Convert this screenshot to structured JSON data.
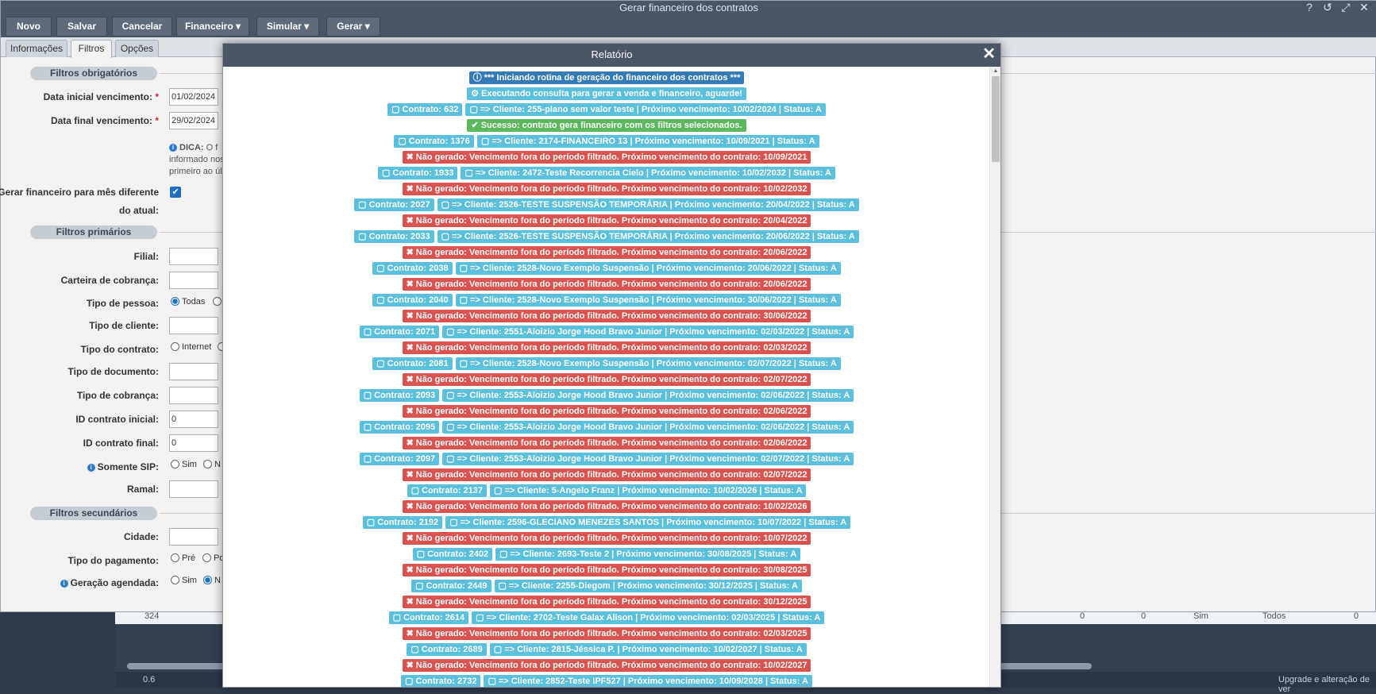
{
  "window": {
    "title": "Gerar financeiro dos contratos",
    "tools": [
      "help-icon",
      "history-icon",
      "expand-icon",
      "close-icon"
    ]
  },
  "toolbar": {
    "novo": "Novo",
    "salvar": "Salvar",
    "cancelar": "Cancelar",
    "financeiro": "Financeiro ▾",
    "simular": "Simular ▾",
    "gerar": "Gerar ▾"
  },
  "tabs": [
    "Informações",
    "Filtros",
    "Opções"
  ],
  "sections": {
    "obrigatorios": "Filtros obrigatórios",
    "primarios": "Filtros primários",
    "secundarios": "Filtros secundários"
  },
  "form": {
    "data_inicial_label": "Data inicial vencimento:",
    "data_inicial_value": "01/02/2024",
    "data_final_label": "Data final vencimento:",
    "data_final_value": "29/02/2024",
    "dica_title": "DICA:",
    "dica_text": "O f informado nos primeiro ao úl",
    "gerar_mes_label_1": "Gerar financeiro para mês diferente",
    "gerar_mes_label_2": "do atual:",
    "filial_label": "Filial:",
    "carteira_label": "Carteira de cobrança:",
    "tipo_pessoa_label": "Tipo de pessoa:",
    "tipo_pessoa_option": "Todas",
    "tipo_cliente_label": "Tipo de cliente:",
    "tipo_contrato_label": "Tipo do contrato:",
    "tipo_contrato_option": "Internet",
    "tipo_documento_label": "Tipo de documento:",
    "tipo_cobranca_label": "Tipo de cobrança:",
    "id_inicial_label": "ID contrato inicial:",
    "id_inicial_value": "0",
    "id_final_label": "ID contrato final:",
    "id_final_value": "0",
    "somente_sip_label": "Somente SIP:",
    "sip_sim": "Sim",
    "sip_nao": "N",
    "ramal_label": "Ramal:",
    "cidade_label": "Cidade:",
    "tipo_pagamento_label": "Tipo do pagamento:",
    "pag_pre": "Pré",
    "pag_pos": "Po",
    "geracao_label": "Geração agendada:",
    "ger_sim": "Sim",
    "ger_nao": "N"
  },
  "background": {
    "row": [
      "324",
      "0",
      "0",
      "Sim",
      "Todos",
      "0"
    ],
    "footer_left": "0.6",
    "footer_right": "Upgrade e alteração de ver"
  },
  "modal": {
    "title": "Relatório",
    "lines": [
      [
        {
          "type": "primary",
          "icon": "ⓘ",
          "text": "*** Iniciando rotina de geração do financeiro dos contratos ***"
        }
      ],
      [
        {
          "type": "info",
          "icon": "⚙",
          "text": "Executando consulta para gerar a venda e financeiro, aguarde!"
        }
      ],
      [
        {
          "type": "info",
          "icon": "▢",
          "text": "Contrato: 632"
        },
        {
          "type": "info",
          "icon": "▢",
          "text": "=> Cliente: 255-plano sem valor teste | Próximo vencimento: 10/02/2024 | Status: A"
        }
      ],
      [
        {
          "type": "success",
          "icon": "✔",
          "text": "Sucesso: contrato gera financeiro com os filtros selecionados."
        }
      ],
      [
        {
          "type": "info",
          "icon": "▢",
          "text": "Contrato: 1376"
        },
        {
          "type": "info",
          "icon": "▢",
          "text": "=> Cliente: 2174-FINANCEIRO 13 | Próximo vencimento: 10/09/2021 | Status: A"
        }
      ],
      [
        {
          "type": "danger",
          "icon": "✖",
          "text": "Não gerado: Vencimento fora do período filtrado. Próximo vencimento do contrato: 10/09/2021"
        }
      ],
      [
        {
          "type": "info",
          "icon": "▢",
          "text": "Contrato: 1933"
        },
        {
          "type": "info",
          "icon": "▢",
          "text": "=> Cliente: 2472-Teste Recorrencia Cielo | Próximo vencimento: 10/02/2032 | Status: A"
        }
      ],
      [
        {
          "type": "danger",
          "icon": "✖",
          "text": "Não gerado: Vencimento fora do período filtrado. Próximo vencimento do contrato: 10/02/2032"
        }
      ],
      [
        {
          "type": "info",
          "icon": "▢",
          "text": "Contrato: 2027"
        },
        {
          "type": "info",
          "icon": "▢",
          "text": "=> Cliente: 2526-TESTE SUSPENSÃO TEMPORÁRIA | Próximo vencimento: 20/04/2022 | Status: A"
        }
      ],
      [
        {
          "type": "danger",
          "icon": "✖",
          "text": "Não gerado: Vencimento fora do período filtrado. Próximo vencimento do contrato: 20/04/2022"
        }
      ],
      [
        {
          "type": "info",
          "icon": "▢",
          "text": "Contrato: 2033"
        },
        {
          "type": "info",
          "icon": "▢",
          "text": "=> Cliente: 2526-TESTE SUSPENSÃO TEMPORÁRIA | Próximo vencimento: 20/06/2022 | Status: A"
        }
      ],
      [
        {
          "type": "danger",
          "icon": "✖",
          "text": "Não gerado: Vencimento fora do período filtrado. Próximo vencimento do contrato: 20/06/2022"
        }
      ],
      [
        {
          "type": "info",
          "icon": "▢",
          "text": "Contrato: 2038"
        },
        {
          "type": "info",
          "icon": "▢",
          "text": "=> Cliente: 2528-Novo Exemplo Suspensão | Próximo vencimento: 20/06/2022 | Status: A"
        }
      ],
      [
        {
          "type": "danger",
          "icon": "✖",
          "text": "Não gerado: Vencimento fora do período filtrado. Próximo vencimento do contrato: 20/06/2022"
        }
      ],
      [
        {
          "type": "info",
          "icon": "▢",
          "text": "Contrato: 2040"
        },
        {
          "type": "info",
          "icon": "▢",
          "text": "=> Cliente: 2528-Novo Exemplo Suspensão | Próximo vencimento: 30/06/2022 | Status: A"
        }
      ],
      [
        {
          "type": "danger",
          "icon": "✖",
          "text": "Não gerado: Vencimento fora do período filtrado. Próximo vencimento do contrato: 30/06/2022"
        }
      ],
      [
        {
          "type": "info",
          "icon": "▢",
          "text": "Contrato: 2071"
        },
        {
          "type": "info",
          "icon": "▢",
          "text": "=> Cliente: 2551-Aloizio Jorge Hood Bravo Junior | Próximo vencimento: 02/03/2022 | Status: A"
        }
      ],
      [
        {
          "type": "danger",
          "icon": "✖",
          "text": "Não gerado: Vencimento fora do período filtrado. Próximo vencimento do contrato: 02/03/2022"
        }
      ],
      [
        {
          "type": "info",
          "icon": "▢",
          "text": "Contrato: 2081"
        },
        {
          "type": "info",
          "icon": "▢",
          "text": "=> Cliente: 2528-Novo Exemplo Suspensão | Próximo vencimento: 02/07/2022 | Status: A"
        }
      ],
      [
        {
          "type": "danger",
          "icon": "✖",
          "text": "Não gerado: Vencimento fora do período filtrado. Próximo vencimento do contrato: 02/07/2022"
        }
      ],
      [
        {
          "type": "info",
          "icon": "▢",
          "text": "Contrato: 2093"
        },
        {
          "type": "info",
          "icon": "▢",
          "text": "=> Cliente: 2553-Aloizio Jorge Hood Bravo Junior | Próximo vencimento: 02/06/2022 | Status: A"
        }
      ],
      [
        {
          "type": "danger",
          "icon": "✖",
          "text": "Não gerado: Vencimento fora do período filtrado. Próximo vencimento do contrato: 02/06/2022"
        }
      ],
      [
        {
          "type": "info",
          "icon": "▢",
          "text": "Contrato: 2095"
        },
        {
          "type": "info",
          "icon": "▢",
          "text": "=> Cliente: 2553-Aloizio Jorge Hood Bravo Junior | Próximo vencimento: 02/06/2022 | Status: A"
        }
      ],
      [
        {
          "type": "danger",
          "icon": "✖",
          "text": "Não gerado: Vencimento fora do período filtrado. Próximo vencimento do contrato: 02/06/2022"
        }
      ],
      [
        {
          "type": "info",
          "icon": "▢",
          "text": "Contrato: 2097"
        },
        {
          "type": "info",
          "icon": "▢",
          "text": "=> Cliente: 2553-Aloizio Jorge Hood Bravo Junior | Próximo vencimento: 02/07/2022 | Status: A"
        }
      ],
      [
        {
          "type": "danger",
          "icon": "✖",
          "text": "Não gerado: Vencimento fora do período filtrado. Próximo vencimento do contrato: 02/07/2022"
        }
      ],
      [
        {
          "type": "info",
          "icon": "▢",
          "text": "Contrato: 2137"
        },
        {
          "type": "info",
          "icon": "▢",
          "text": "=> Cliente: 5-Angelo Franz | Próximo vencimento: 10/02/2026 | Status: A"
        }
      ],
      [
        {
          "type": "danger",
          "icon": "✖",
          "text": "Não gerado: Vencimento fora do período filtrado. Próximo vencimento do contrato: 10/02/2026"
        }
      ],
      [
        {
          "type": "info",
          "icon": "▢",
          "text": "Contrato: 2192"
        },
        {
          "type": "info",
          "icon": "▢",
          "text": "=> Cliente: 2596-GLECIANO MENEZES SANTOS | Próximo vencimento: 10/07/2022 | Status: A"
        }
      ],
      [
        {
          "type": "danger",
          "icon": "✖",
          "text": "Não gerado: Vencimento fora do período filtrado. Próximo vencimento do contrato: 10/07/2022"
        }
      ],
      [
        {
          "type": "info",
          "icon": "▢",
          "text": "Contrato: 2402"
        },
        {
          "type": "info",
          "icon": "▢",
          "text": "=> Cliente: 2693-Teste 2 | Próximo vencimento: 30/08/2025 | Status: A"
        }
      ],
      [
        {
          "type": "danger",
          "icon": "✖",
          "text": "Não gerado: Vencimento fora do período filtrado. Próximo vencimento do contrato: 30/08/2025"
        }
      ],
      [
        {
          "type": "info",
          "icon": "▢",
          "text": "Contrato: 2449"
        },
        {
          "type": "info",
          "icon": "▢",
          "text": "=> Cliente: 2255-Diegom | Próximo vencimento: 30/12/2025 | Status: A"
        }
      ],
      [
        {
          "type": "danger",
          "icon": "✖",
          "text": "Não gerado: Vencimento fora do período filtrado. Próximo vencimento do contrato: 30/12/2025"
        }
      ],
      [
        {
          "type": "info",
          "icon": "▢",
          "text": "Contrato: 2614"
        },
        {
          "type": "info",
          "icon": "▢",
          "text": "=> Cliente: 2702-Teste Galax Alison | Próximo vencimento: 02/03/2025 | Status: A"
        }
      ],
      [
        {
          "type": "danger",
          "icon": "✖",
          "text": "Não gerado: Vencimento fora do período filtrado. Próximo vencimento do contrato: 02/03/2025"
        }
      ],
      [
        {
          "type": "info",
          "icon": "▢",
          "text": "Contrato: 2689"
        },
        {
          "type": "info",
          "icon": "▢",
          "text": "=> Cliente: 2815-Jéssica P. | Próximo vencimento: 10/02/2027 | Status: A"
        }
      ],
      [
        {
          "type": "danger",
          "icon": "✖",
          "text": "Não gerado: Vencimento fora do período filtrado. Próximo vencimento do contrato: 10/02/2027"
        }
      ],
      [
        {
          "type": "info",
          "icon": "▢",
          "text": "Contrato: 2732"
        },
        {
          "type": "info",
          "icon": "▢",
          "text": "=> Cliente: 2852-Teste IPF527 | Próximo vencimento: 10/09/2028 | Status: A"
        }
      ]
    ]
  }
}
